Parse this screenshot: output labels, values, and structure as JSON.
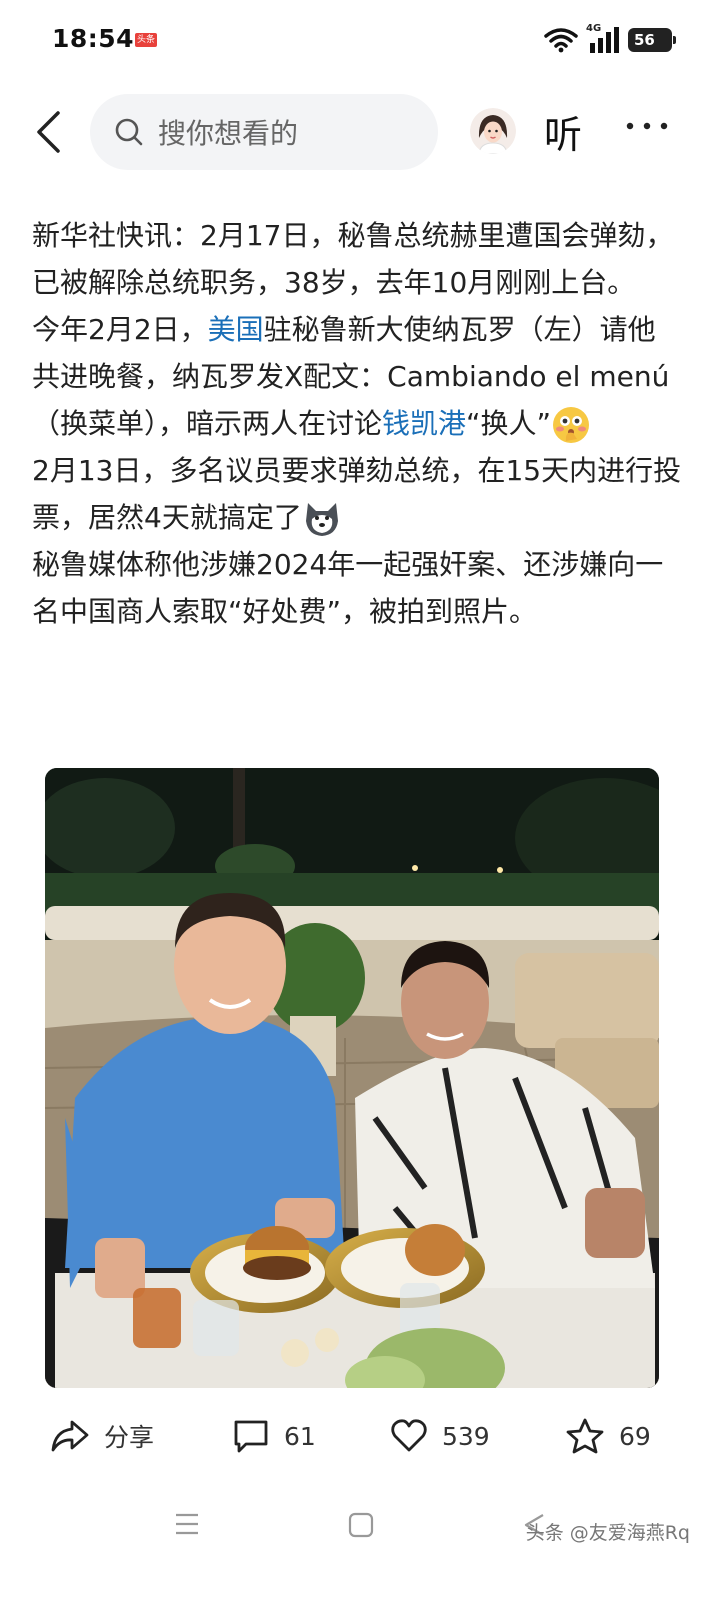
{
  "status_bar": {
    "time": "18:54",
    "app_badge": "头条",
    "network": "4G",
    "battery": "56"
  },
  "header": {
    "search_placeholder": "搜你想看的",
    "listen_label": "听"
  },
  "article": {
    "paragraphs": [
      {
        "segments": [
          {
            "text": "新华社快讯：2月17日，秘鲁总统赫里遭国会弹劾，已被解除总统职务，38岁，去年10月刚刚上台。"
          }
        ]
      },
      {
        "segments": [
          {
            "text": "今年2月2日，"
          },
          {
            "text": "美国",
            "link": true
          },
          {
            "text": "驻秘鲁新大使纳瓦罗（左）请他共进晚餐，纳瓦罗发X配文：Cambiando el menú（换菜单），暗示两人在讨论"
          },
          {
            "text": "钱凯港",
            "link": true
          },
          {
            "text": "“换人”"
          }
        ],
        "emoji": "flushed-hand-emoji"
      },
      {
        "segments": [
          {
            "text": "2月13日，多名议员要求弹劾总统，在15天内进行投票，居然4天就搞定了"
          }
        ],
        "emoji": "husky-emoji"
      },
      {
        "segments": [
          {
            "text": "秘鲁媒体称他涉嫌2024年一起强奸案、还涉嫌向一名中国商人索取“好处费”，被拍到照片。"
          }
        ]
      }
    ]
  },
  "actions": {
    "share_label": "分享",
    "comment_count": "61",
    "like_count": "539",
    "favorite_count": "69"
  },
  "watermark": "头条 @友爱海燕Rq",
  "colors": {
    "link": "#1a6fb8",
    "search_bg": "#f3f4f6"
  }
}
